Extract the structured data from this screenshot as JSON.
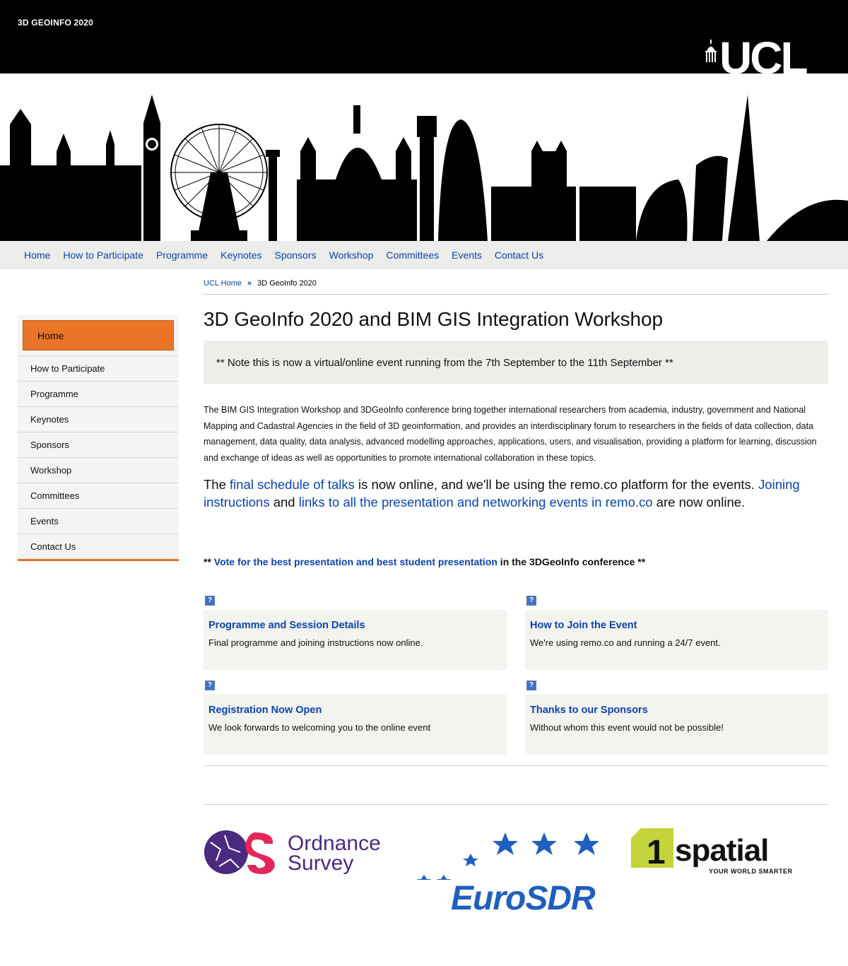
{
  "header": {
    "site_name": "3D GEOINFO 2020",
    "logo_text": "UCL"
  },
  "nav": {
    "items": [
      {
        "label": "Home"
      },
      {
        "label": "How to Participate"
      },
      {
        "label": "Programme"
      },
      {
        "label": "Keynotes"
      },
      {
        "label": "Sponsors"
      },
      {
        "label": "Workshop"
      },
      {
        "label": "Committees"
      },
      {
        "label": "Events"
      },
      {
        "label": "Contact Us"
      }
    ]
  },
  "breadcrumb": {
    "home": "UCL Home",
    "separator": "»",
    "current": "3D GeoInfo 2020"
  },
  "sidebar": {
    "active": "Home",
    "items": [
      {
        "label": "How to Participate"
      },
      {
        "label": "Programme"
      },
      {
        "label": "Keynotes"
      },
      {
        "label": "Sponsors"
      },
      {
        "label": "Workshop"
      },
      {
        "label": "Committees"
      },
      {
        "label": "Events"
      },
      {
        "label": "Contact Us"
      }
    ]
  },
  "main": {
    "title": "3D GeoInfo 2020 and BIM GIS Integration Workshop",
    "notice": "** Note this is now a virtual/online event running from the 7th September to the 11th September **",
    "intro": "The BIM GIS Integration Workshop and 3DGeoInfo conference bring together  international researchers from academia, industry, government and National Mapping and Cadastral Agencies in the field of 3D geoinformation, and provides an interdisciplinary forum to researchers in the fields of data collection, data management, data quality, data analysis, advanced modelling approaches, applications, users, and visualisation, providing a platform for learning, discussion and exchange of ideas as well as opportunities to promote international collaboration in these topics.",
    "announce": {
      "p1": "The ",
      "link1": "final schedule of talks",
      "p2": " is now online, and we'll be using the remo.co platform for the events.  ",
      "link2": "Joining instructions",
      "p3": " and ",
      "link3": "links to all the presentation and networking events in remo.co",
      "p4": " are now online."
    },
    "vote": {
      "prefix": "** ",
      "link": "Vote for the best presentation and best student presentation",
      "suffix": " in the 3DGeoInfo conference **"
    }
  },
  "cards": [
    {
      "title": "Programme and Session Details",
      "text": "Final programme and joining instructions now online."
    },
    {
      "title": "How to Join the Event",
      "text": "We're using remo.co and running a 24/7 event."
    },
    {
      "title": "Registration Now Open",
      "text": "We look forwards to welcoming you to the online event"
    },
    {
      "title": "Thanks to our Sponsors",
      "text": "Without whom this event would not be possible!"
    }
  ],
  "sponsors": {
    "ordnance": {
      "line1": "Ordnance",
      "line2": "Survey"
    },
    "eurosdr": {
      "name": "EuroSDR"
    },
    "spatial": {
      "digit": "1",
      "name": "spatial",
      "tagline": "YOUR WORLD SMARTER"
    }
  },
  "colors": {
    "link": "#0b44ad",
    "accent": "#ea7427",
    "nav_bg": "#ececea",
    "topbar": "#000000"
  }
}
